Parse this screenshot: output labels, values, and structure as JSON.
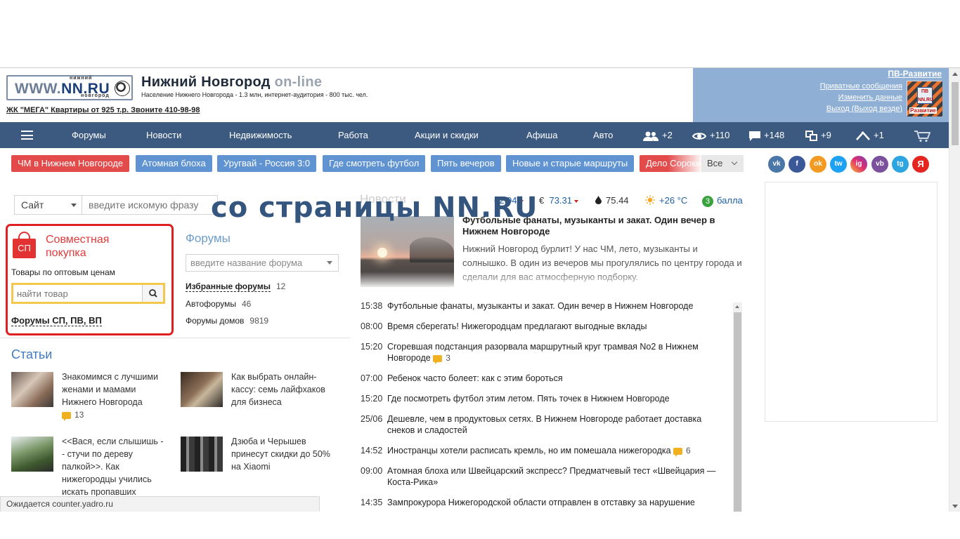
{
  "header": {
    "logo_www": "WWW.",
    "logo_nn": "NN.RU",
    "logo_top": "нижний",
    "logo_bottom": "новгород",
    "title_main": "Нижний Новгород",
    "title_online": "on-line",
    "population": "Население Нижнего Новгорода - 1.3 млн, интернет-аудитория - 800 тыс. чел.",
    "ad_link": "ЖК \"МЕГА\" Квартиры от 925 т.р. Звоните 410-98-98"
  },
  "userbox": {
    "pv_title": "ПВ-Развитие",
    "private_messages": "Приватные сообщения",
    "change_data": "Изменить данные",
    "logout": "Выход (Выход везде)",
    "pv_box_text": "ПВ NN.RU",
    "pv_razv": "Развитие"
  },
  "nav": {
    "items": [
      "Форумы",
      "Новости",
      "Недвижимость",
      "Работа",
      "Акции и скидки",
      "Афиша",
      "Авто"
    ],
    "stats": [
      "+2",
      "+110",
      "+148",
      "+9",
      "+1"
    ]
  },
  "tags": {
    "items": [
      "ЧМ в Нижнем Новгороде",
      "Атомная блоха",
      "Уругвай - Россия 3:0",
      "Где смотреть футбол",
      "Пять вечеров",
      "Новые и старые маршруты",
      "Дело Сорокина"
    ],
    "all_label": "Все"
  },
  "social": [
    "vk",
    "f",
    "ok",
    "tw",
    "ig",
    "vb",
    "tg",
    "Я"
  ],
  "colors": {
    "nav_bg": "#3c5a80",
    "userbox_bg": "#8fb0d4",
    "tag_red": "#e34a4a",
    "tag_blue": "#5f93d2",
    "sp_border": "#e02020"
  },
  "search": {
    "scope": "Сайт",
    "placeholder": "введите искомую фразу"
  },
  "sp": {
    "title": "Совместная покупка",
    "icon_text": "СП",
    "subtitle": "Товары по оптовым ценам",
    "placeholder": "найти товар",
    "link": "Форумы СП, ПВ, ВП"
  },
  "forums": {
    "title": "Форумы",
    "placeholder": "введите название форума",
    "rows": [
      {
        "label": "Избранные форумы",
        "count": "12"
      },
      {
        "label": "Автофорумы",
        "count": "46"
      },
      {
        "label": "Форумы домов",
        "count": "9819"
      }
    ]
  },
  "articles": {
    "title": "Статьи",
    "items": [
      {
        "text": "Знакомимся с лучшими женами и мамами Нижнего Новгорода",
        "comments": "13"
      },
      {
        "text": "Как выбрать онлайн-кассу: семь лайфхаков для бизнеса",
        "comments": ""
      },
      {
        "text": "<<Вася, если слышишь - - стучи по дереву палкой>>. Как нижегородцы учились искать пропавших",
        "comments": ""
      },
      {
        "text": "Дзюба и Черышев принесут скидки до 50% на Xiaomi",
        "comments": ""
      }
    ]
  },
  "rates": {
    "news_title": "Новости",
    "usd": "62.94",
    "eur_sign": "€",
    "eur": "73.31",
    "oil": "75.44",
    "weather": "+26 °C",
    "score_num": "3",
    "score_label": "балла"
  },
  "featured": {
    "title": "Футбольные фанаты, музыканты и закат. Один вечер в Нижнем Новгороде",
    "text": "Нижний Новгород бурлит! У нас ЧМ, лето, музыканты и солнышко. В один из вечеров мы прогулялись по центру города и сделали для вас атмосферную подборку."
  },
  "news": [
    {
      "time": "15:38",
      "title": "Футбольные фанаты, музыканты и закат. Один вечер в Нижнем Новгороде",
      "comments": ""
    },
    {
      "time": "08:00",
      "title": "Время сберегать! Нижегородцам предлагают выгодные вклады",
      "comments": ""
    },
    {
      "time": "15:20",
      "title": "Сгоревшая подстанция разорвала маршрутный круг трамвая No2 в Нижнем Новгороде",
      "comments": "3"
    },
    {
      "time": "07:00",
      "title": "Ребенок часто болеет: как с этим бороться",
      "comments": ""
    },
    {
      "time": "15:20",
      "title": "Где посмотреть футбол этим летом. Пять точек в Нижнем Новгороде",
      "comments": ""
    },
    {
      "time": "25/06",
      "title": "Дешевле, чем в продуктовых сетях. В Нижнем Новгороде работает доставка снеков и сладостей",
      "comments": ""
    },
    {
      "time": "14:52",
      "title": "Иностранцы хотели расписать кремль, но им помешала нижегородка",
      "comments": "6"
    },
    {
      "time": "09:00",
      "title": "Атомная блоха или Швейцарский экспресс? Предматчевый тест «Швейцария — Коста-Рика»",
      "comments": ""
    },
    {
      "time": "14:35",
      "title": "Зампрокурора Нижегородской области отправлен в отставку за нарушение",
      "comments": ""
    }
  ],
  "overlay": {
    "watermark": "со страницы NN.RU"
  },
  "status": {
    "text": "Ожидается counter.yadro.ru"
  }
}
